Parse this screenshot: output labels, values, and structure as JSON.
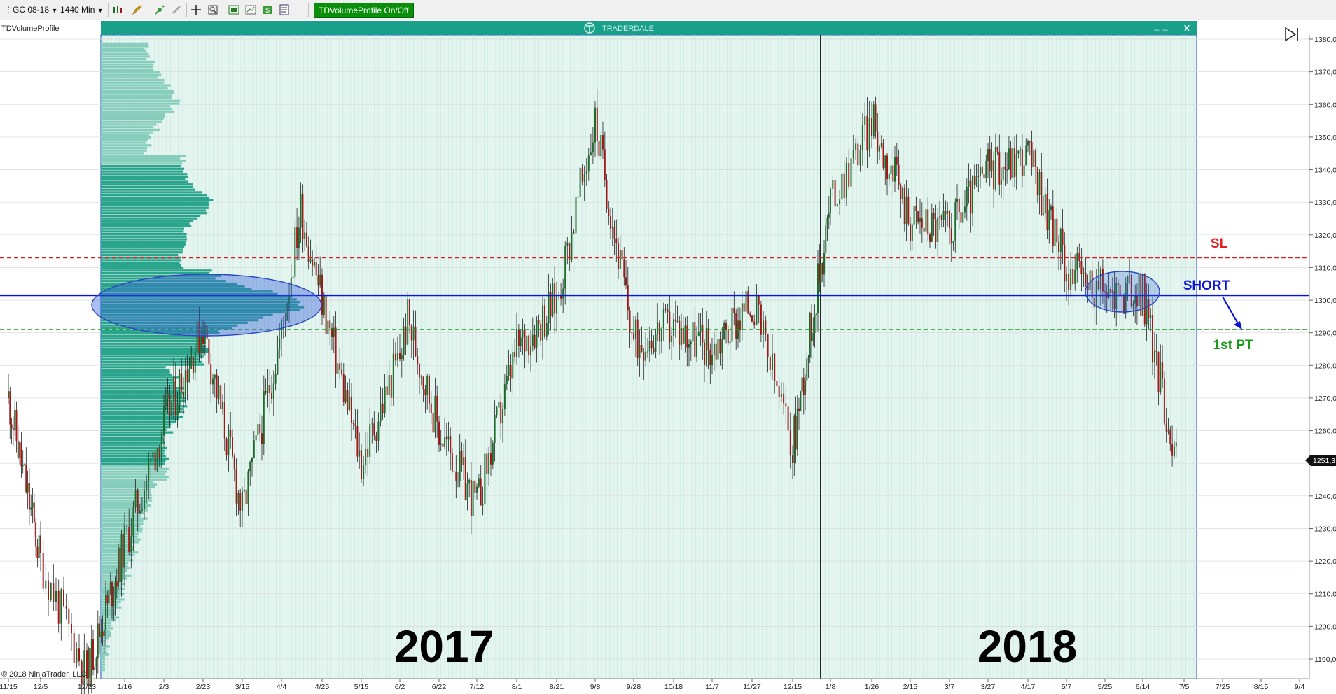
{
  "toolbar": {
    "instrument": "GC 08-18",
    "interval": "1440 Min",
    "td_button": "TDVolumeProfile On/Off"
  },
  "indicator_label": "TDVolumeProfile",
  "window": {
    "title": "TRADERDALE",
    "arrows": "←→",
    "close": "X"
  },
  "copyright": "© 2018 NinjaTrader, LLC",
  "price_marker": "1251,3",
  "annotations": {
    "sl": "SL",
    "short": "SHORT",
    "pt": "1st PT",
    "year1": "2017",
    "year2": "2018"
  },
  "colors": {
    "background": "#ffffff",
    "profile_bg": "#e4f5f0",
    "profile_header": "#18a08a",
    "volume_profile": "#2aa58c",
    "volume_profile_light": "#86cdbb",
    "candle_up": "#1e6b2c",
    "candle_down": "#a01818",
    "sl_line": "#e02020",
    "entry_line": "#0a14d8",
    "pt_line": "#1a9a1a",
    "highlight": "#3a64d8"
  },
  "chart_data": {
    "type": "candlestick",
    "instrument": "GC 08-18",
    "interval": "1440 Min",
    "y_ticks": [
      "1190,0",
      "1200,0",
      "1210,0",
      "1220,0",
      "1230,0",
      "1240,0",
      "1250,0",
      "1260,0",
      "1270,0",
      "1280,0",
      "1290,0",
      "1300,0",
      "1310,0",
      "1320,0",
      "1330,0",
      "1340,0",
      "1350,0",
      "1360,0",
      "1370,0",
      "1380,0"
    ],
    "ylim": [
      1187,
      1382
    ],
    "x_ticks": [
      "11/15",
      "12/5",
      "12/23",
      "1/16",
      "2/3",
      "2/23",
      "3/15",
      "4/4",
      "4/25",
      "5/15",
      "6/2",
      "6/22",
      "7/12",
      "8/1",
      "8/21",
      "9/8",
      "9/28",
      "10/18",
      "11/7",
      "11/27",
      "12/15",
      "1/8",
      "1/26",
      "2/15",
      "3/7",
      "3/27",
      "4/17",
      "5/7",
      "5/25",
      "6/14",
      "7/5",
      "7/25",
      "8/15",
      "9/4"
    ],
    "levels": {
      "stop_loss": 1313,
      "short_entry": 1301.5,
      "first_profit_target": 1291
    },
    "last_price": 1251.3,
    "anchors": [
      {
        "date": "11/15",
        "price": 1270
      },
      {
        "date": "12/5",
        "price": 1220
      },
      {
        "date": "12/23",
        "price": 1185
      },
      {
        "date": "1/16",
        "price": 1225
      },
      {
        "date": "2/3",
        "price": 1262
      },
      {
        "date": "2/23",
        "price": 1292
      },
      {
        "date": "3/15",
        "price": 1235
      },
      {
        "date": "4/4",
        "price": 1290
      },
      {
        "date": "4/14",
        "price": 1328
      },
      {
        "date": "4/25",
        "price": 1300
      },
      {
        "date": "5/15",
        "price": 1250
      },
      {
        "date": "6/2",
        "price": 1283
      },
      {
        "date": "6/6",
        "price": 1294
      },
      {
        "date": "6/22",
        "price": 1260
      },
      {
        "date": "7/12",
        "price": 1237
      },
      {
        "date": "8/1",
        "price": 1285
      },
      {
        "date": "8/21",
        "price": 1300
      },
      {
        "date": "9/8",
        "price": 1355
      },
      {
        "date": "9/28",
        "price": 1287
      },
      {
        "date": "10/18",
        "price": 1292
      },
      {
        "date": "11/7",
        "price": 1285
      },
      {
        "date": "11/27",
        "price": 1300
      },
      {
        "date": "12/15",
        "price": 1255
      },
      {
        "date": "1/8",
        "price": 1330
      },
      {
        "date": "1/26",
        "price": 1355
      },
      {
        "date": "2/15",
        "price": 1325
      },
      {
        "date": "3/7",
        "price": 1322
      },
      {
        "date": "3/27",
        "price": 1340
      },
      {
        "date": "4/17",
        "price": 1345
      },
      {
        "date": "5/7",
        "price": 1310
      },
      {
        "date": "5/25",
        "price": 1302
      },
      {
        "date": "6/14",
        "price": 1302
      },
      {
        "date": "7/1",
        "price": 1251
      }
    ]
  }
}
